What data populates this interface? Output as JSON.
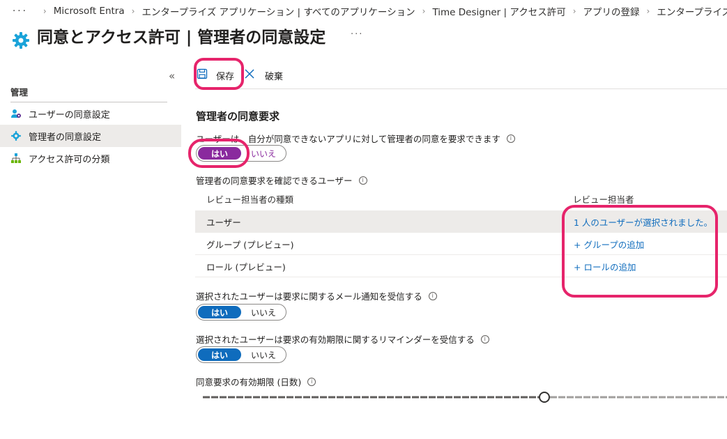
{
  "breadcrumb": {
    "more": "···",
    "items": [
      "Microsoft Entra",
      "エンタープライズ アプリケーション | すべてのアプリケーション",
      "Time Designer | アクセス許可",
      "アプリの登録",
      "エンタープライズ ア"
    ]
  },
  "header": {
    "title": "同意とアクセス許可 | 管理者の同意設定",
    "more": "···",
    "icon": "gear-icon"
  },
  "sidebar": {
    "collapse": "«",
    "section": "管理",
    "items": [
      {
        "label": "ユーザーの同意設定",
        "icon": "users-gear-icon",
        "active": false
      },
      {
        "label": "管理者の同意設定",
        "icon": "gear-icon",
        "active": true
      },
      {
        "label": "アクセス許可の分類",
        "icon": "hierarchy-icon",
        "active": false
      }
    ]
  },
  "toolbar": {
    "save": "保存",
    "discard": "破棄"
  },
  "main": {
    "heading": "管理者の同意要求",
    "request_label": "ユーザーは、自分が同意できないアプリに対して管理者の同意を要求できます",
    "request_toggle": {
      "on": "はい",
      "off": "いいえ",
      "value": "はい"
    },
    "reviewers_label": "管理者の同意要求を確認できるユーザー",
    "table": {
      "headers": [
        "レビュー担当者の種類",
        "レビュー担当者"
      ],
      "rows": [
        {
          "type": "ユーザー",
          "reviewer": "1 人のユーザーが選択されました。"
        },
        {
          "type": "グループ (プレビュー)",
          "reviewer": "+ グループの追加"
        },
        {
          "type": "ロール (プレビュー)",
          "reviewer": "+ ロールの追加"
        }
      ]
    },
    "email_label": "選択されたユーザーは要求に関するメール通知を受信する",
    "email_toggle": {
      "on": "はい",
      "off": "いいえ",
      "value": "はい"
    },
    "reminder_label": "選択されたユーザーは要求の有効期限に関するリマインダーを受信する",
    "reminder_toggle": {
      "on": "はい",
      "off": "いいえ",
      "value": "はい"
    },
    "expiry_label": "同意要求の有効期限 (日数)"
  },
  "colors": {
    "accent_purple": "#8a2a9e",
    "accent_blue": "#0f6cbd",
    "highlight": "#e6246b"
  }
}
